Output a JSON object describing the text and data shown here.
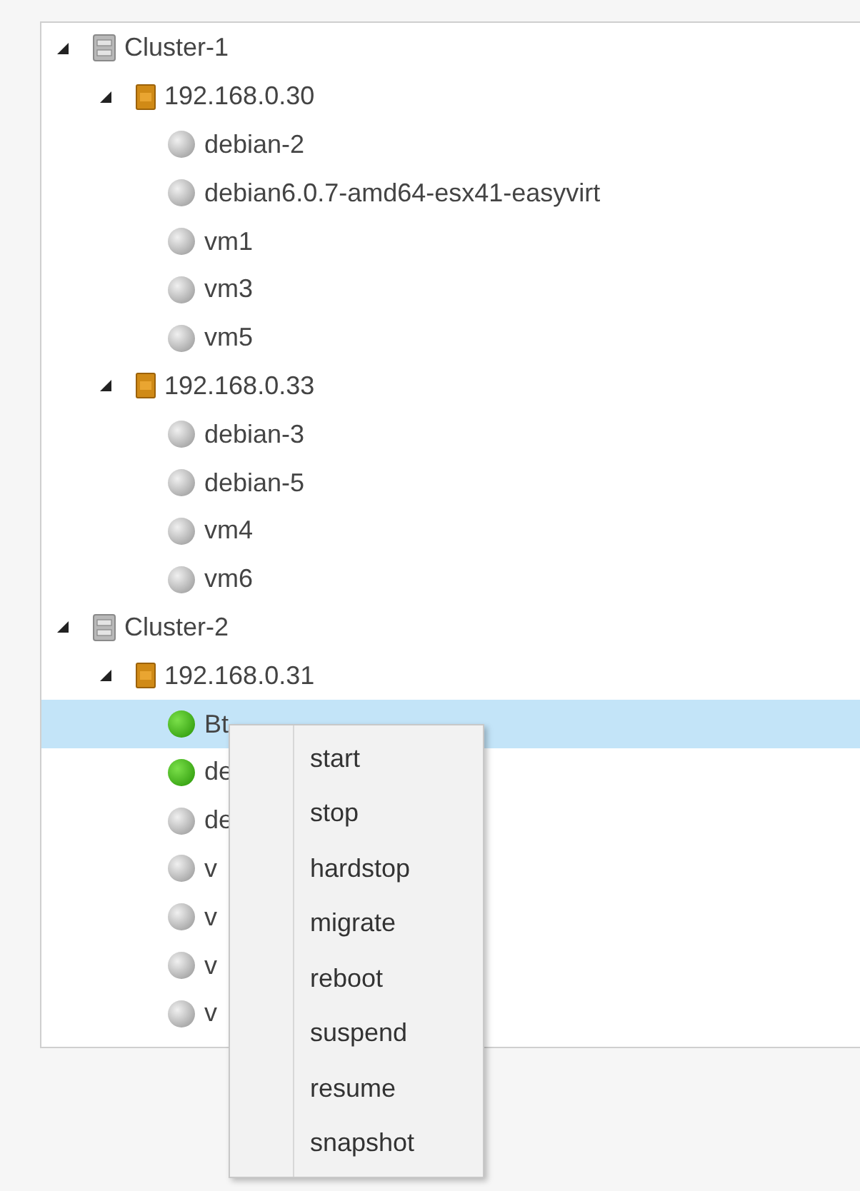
{
  "tree": [
    {
      "kind": "cluster",
      "label": "Cluster-1",
      "expanded": true,
      "children": [
        {
          "kind": "host",
          "label": "192.168.0.30",
          "expanded": true,
          "children": [
            {
              "kind": "vm",
              "label": "debian-2",
              "running": false,
              "selected": false
            },
            {
              "kind": "vm",
              "label": "debian6.0.7-amd64-esx41-easyvirt",
              "running": false,
              "selected": false
            },
            {
              "kind": "vm",
              "label": "vm1",
              "running": false,
              "selected": false
            },
            {
              "kind": "vm",
              "label": "vm3",
              "running": false,
              "selected": false
            },
            {
              "kind": "vm",
              "label": "vm5",
              "running": false,
              "selected": false
            }
          ]
        },
        {
          "kind": "host",
          "label": "192.168.0.33",
          "expanded": true,
          "children": [
            {
              "kind": "vm",
              "label": "debian-3",
              "running": false,
              "selected": false
            },
            {
              "kind": "vm",
              "label": "debian-5",
              "running": false,
              "selected": false
            },
            {
              "kind": "vm",
              "label": "vm4",
              "running": false,
              "selected": false
            },
            {
              "kind": "vm",
              "label": "vm6",
              "running": false,
              "selected": false
            }
          ]
        }
      ]
    },
    {
      "kind": "cluster",
      "label": "Cluster-2",
      "expanded": true,
      "children": [
        {
          "kind": "host",
          "label": "192.168.0.31",
          "expanded": true,
          "children": [
            {
              "kind": "vm",
              "label": "Bt",
              "running": true,
              "selected": true
            },
            {
              "kind": "vm",
              "label": "de",
              "running": true,
              "selected": false
            },
            {
              "kind": "vm",
              "label": "de",
              "running": false,
              "selected": false
            },
            {
              "kind": "vm",
              "label": "v",
              "running": false,
              "selected": false
            },
            {
              "kind": "vm",
              "label": "v",
              "running": false,
              "selected": false
            },
            {
              "kind": "vm",
              "label": "v",
              "running": false,
              "selected": false
            },
            {
              "kind": "vm",
              "label": "v",
              "running": false,
              "selected": false
            }
          ]
        }
      ]
    }
  ],
  "context_menu": [
    "start",
    "stop",
    "hardstop",
    "migrate",
    "reboot",
    "suspend",
    "resume",
    "snapshot"
  ]
}
